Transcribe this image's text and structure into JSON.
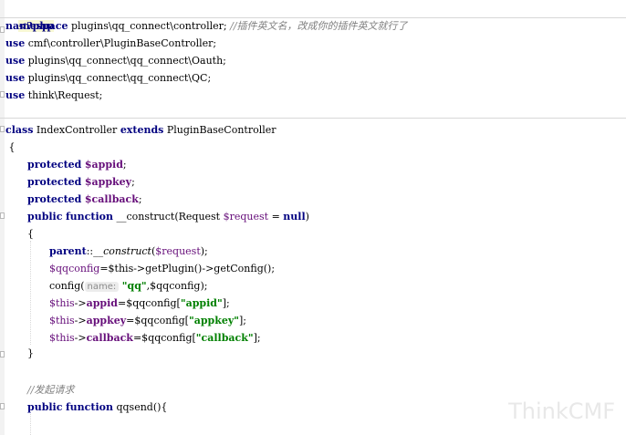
{
  "code": {
    "php_open": "<?php",
    "namespace_kw": "namespace",
    "namespace_path": " plugins\\qq_connect\\controller; ",
    "namespace_comment": "//插件英文名，改成你的插件英文就行了",
    "use_kw": "use",
    "use1": " cmf\\controller\\PluginBaseController;",
    "use2": " plugins\\qq_connect\\qq_connect\\Oauth;",
    "use3": " plugins\\qq_connect\\qq_connect\\QC;",
    "use4": " think\\Request;",
    "class_kw": "class",
    "class_name": " IndexController ",
    "extends_kw": "extends",
    "parent_class": " PluginBaseController",
    "brace_open": " {",
    "protected_kw": "protected",
    "prop_appid": "$appid",
    "prop_appkey": "$appkey",
    "prop_callback": "$callback",
    "semicolon": ";",
    "public_kw": "public",
    "function_kw": "function",
    "construct_sig": " __construct(Request ",
    "request_var": "$request",
    "assign_eq": " = ",
    "null_kw": "null",
    "close_paren": ")",
    "method_brace_open": "{",
    "parent_kw": "parent",
    "scope_op": "::",
    "construct_call": "__construct",
    "paren_open": "(",
    "call_close": ");",
    "qqconfig_var": "$qqconfig",
    "this_var": "$this",
    "get_plugin_part": "=$this->getPlugin()->getConfig();",
    "config_call": "config(",
    "param_hint": "name:",
    "qq_string": "\"qq\"",
    "config_rest": ",$qqconfig);",
    "arrow": "->",
    "appid_prop": "appid",
    "appkey_prop": "appkey",
    "callback_prop": "callback",
    "index_open": "=$qqconfig[",
    "index_close": "];",
    "appid_str": "\"appid\"",
    "appkey_str": "\"appkey\"",
    "callback_str": "\"callback\"",
    "method_brace_close": "}",
    "send_comment": "//发起请求",
    "qqsend_sig": " qqsend(){"
  },
  "watermark": "ThinkCMF"
}
